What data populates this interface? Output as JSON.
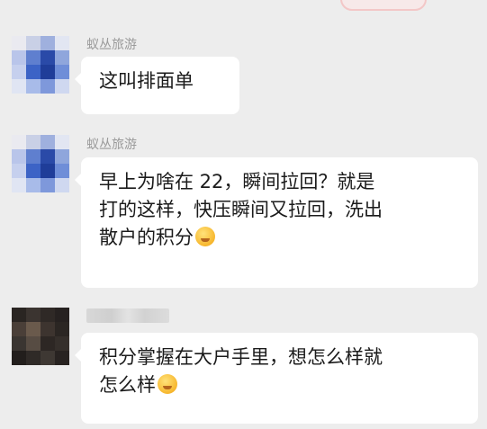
{
  "messages": [
    {
      "sender": "蚁丛旅游",
      "lines": [
        "这叫排面单"
      ]
    },
    {
      "sender": "蚁丛旅游",
      "lines": [
        "早上为啥在 22，瞬间拉回？就是",
        "打的这样，快压瞬间又拉回，洗出",
        "散户的积分"
      ],
      "emoji": "thinking-face-icon"
    },
    {
      "sender": "",
      "lines": [
        "积分掌握在大户手里，想怎么样就",
        "怎么样"
      ],
      "emoji": "relieved-face-icon"
    }
  ],
  "colors": {
    "background": "#ededed",
    "bubble": "#ffffff",
    "sender_name": "#9a9a9a",
    "text": "#1b1b1b"
  }
}
